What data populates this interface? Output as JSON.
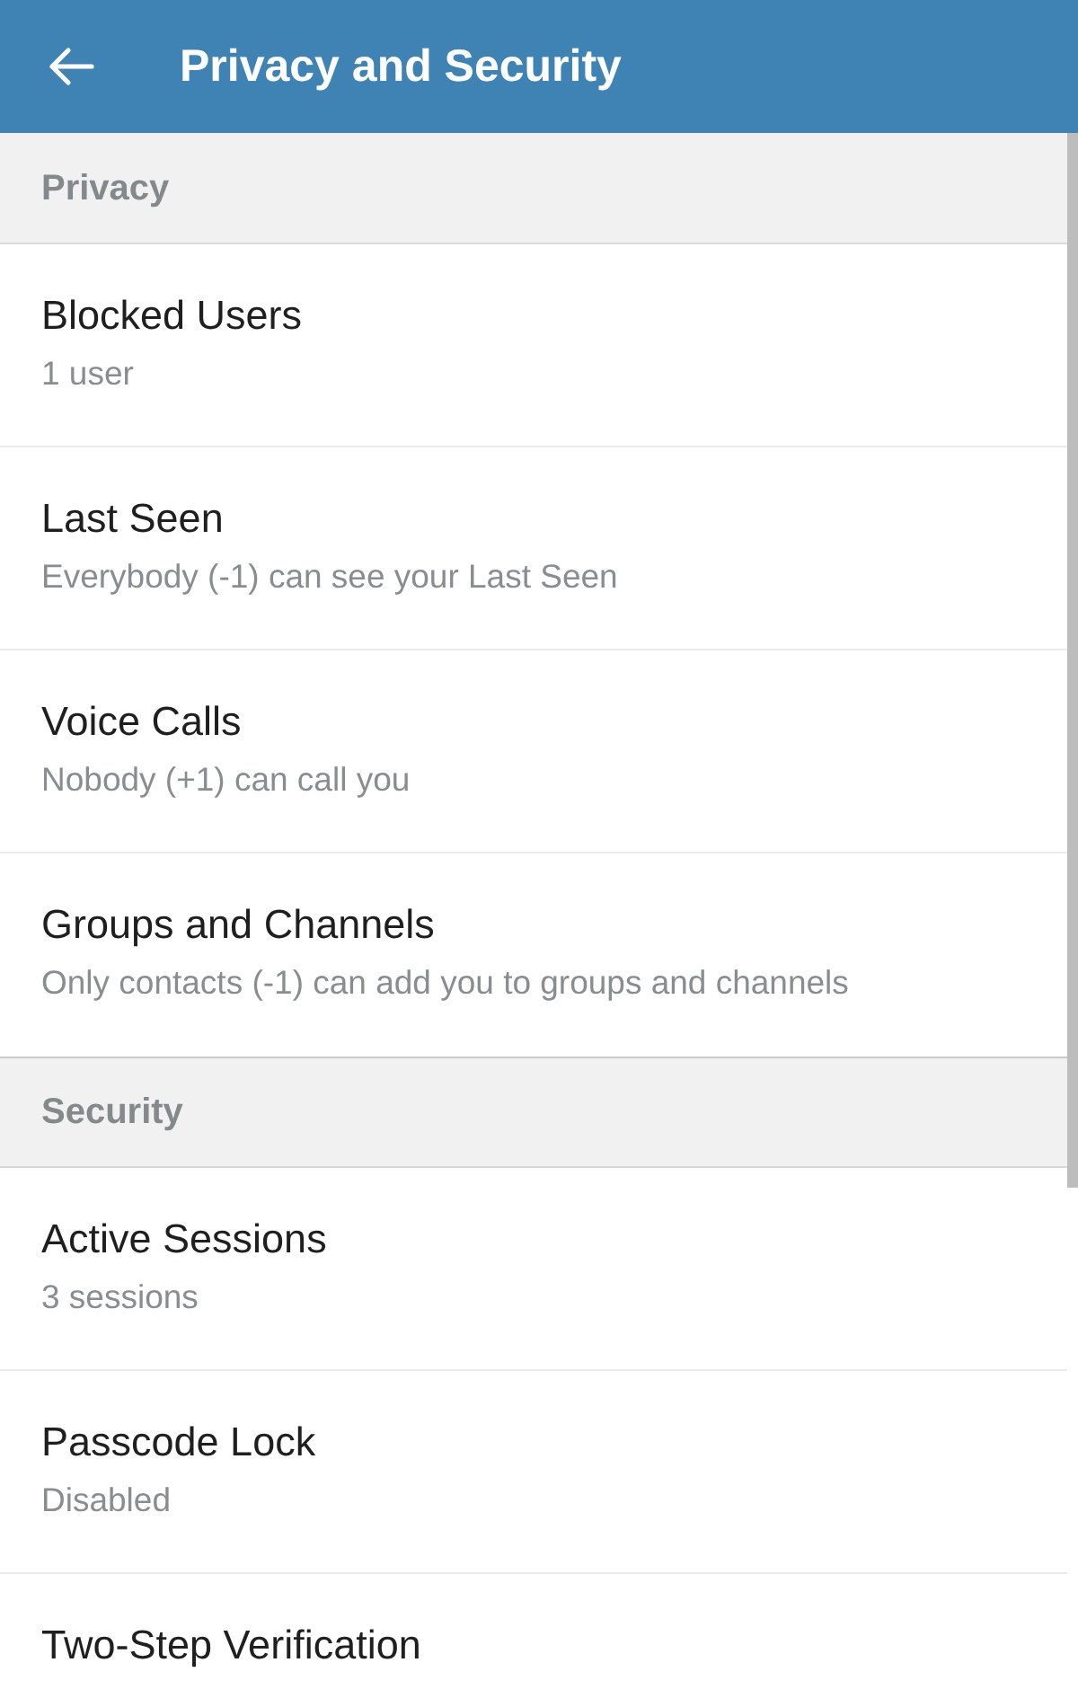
{
  "app_bar": {
    "title": "Privacy and Security"
  },
  "sections": [
    {
      "header": "Privacy",
      "items": [
        {
          "title": "Blocked Users",
          "subtitle": "1 user"
        },
        {
          "title": "Last Seen",
          "subtitle": "Everybody (-1) can see your Last Seen"
        },
        {
          "title": "Voice Calls",
          "subtitle": "Nobody (+1) can call you"
        },
        {
          "title": "Groups and Channels",
          "subtitle": "Only contacts (-1) can add you to groups and channels"
        }
      ]
    },
    {
      "header": "Security",
      "items": [
        {
          "title": "Active Sessions",
          "subtitle": "3 sessions"
        },
        {
          "title": "Passcode Lock",
          "subtitle": "Disabled"
        },
        {
          "title": "Two-Step Verification"
        }
      ]
    }
  ]
}
